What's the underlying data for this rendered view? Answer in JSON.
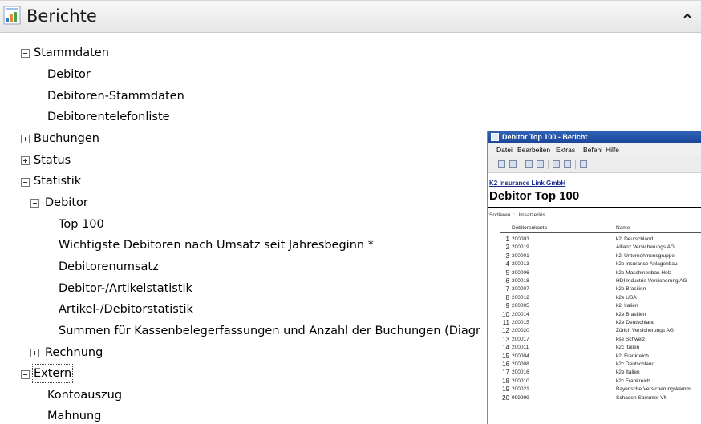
{
  "header": {
    "title": "Berichte",
    "icon": "report-chart-icon",
    "collapse_icon": "chevron-up-icon"
  },
  "tree": {
    "stammdaten": {
      "label": "Stammdaten",
      "children": [
        "Debitor",
        "Debitoren-Stammdaten",
        "Debitorentelefonliste"
      ]
    },
    "buchungen": {
      "label": "Buchungen"
    },
    "status": {
      "label": "Status"
    },
    "statistik": {
      "label": "Statistik"
    },
    "debitor": {
      "label": "Debitor",
      "children": [
        "Top 100",
        "Wichtigste Debitoren nach Umsatz seit Jahresbeginn *",
        "Debitorenumsatz",
        "Debitor-/Artikelstatistik",
        "Artikel-/Debitorstatistik",
        "Summen für Kassenbelegerfassungen und Anzahl der Buchungen (Diagra"
      ]
    },
    "rechnung": {
      "label": "Rechnung"
    },
    "extern": {
      "label": "Extern",
      "children": [
        "Kontoauszug",
        "Mahnung"
      ]
    }
  },
  "report_window": {
    "title": "Debitor Top 100 - Bericht",
    "menu": [
      "Datei",
      "Bearbeiten",
      "Extras",
      "Befehl",
      "Hilfe"
    ],
    "company": "K2 Insurance Link GmbH",
    "report_title": "Debitor Top 100",
    "sort_label": "Sortieren  .: Umsatzerlös",
    "col_account": "Debitorenkonto",
    "col_name": "Name",
    "rows": [
      {
        "rank": "1",
        "account": "200003",
        "name": "k2i Deutschland"
      },
      {
        "rank": "2",
        "account": "200019",
        "name": "Allianz Versicherungs AG"
      },
      {
        "rank": "3",
        "account": "200001",
        "name": "k2i Unternehmensgruppe"
      },
      {
        "rank": "4",
        "account": "200013",
        "name": "k2e insurance Anlagenbau"
      },
      {
        "rank": "5",
        "account": "200006",
        "name": "k2e Maschinenbau Holz"
      },
      {
        "rank": "6",
        "account": "200018",
        "name": "HDI Industrie Versicherung AG"
      },
      {
        "rank": "7",
        "account": "200007",
        "name": "k2e Brasilien"
      },
      {
        "rank": "8",
        "account": "200012",
        "name": "k2e USA"
      },
      {
        "rank": "9",
        "account": "200005",
        "name": "k2i Italien"
      },
      {
        "rank": "10",
        "account": "200014",
        "name": "k2e Brasilien"
      },
      {
        "rank": "11",
        "account": "200015",
        "name": "k2e Deutschland"
      },
      {
        "rank": "12",
        "account": "200020",
        "name": "Zürich Versicherungs AG"
      },
      {
        "rank": "13",
        "account": "200017",
        "name": "kse Schweiz"
      },
      {
        "rank": "14",
        "account": "200011",
        "name": "k2c Italien"
      },
      {
        "rank": "15",
        "account": "200004",
        "name": "k2i Frankreich"
      },
      {
        "rank": "16",
        "account": "200008",
        "name": "k2c Deutschland"
      },
      {
        "rank": "17",
        "account": "200016",
        "name": "k2e Italien"
      },
      {
        "rank": "18",
        "account": "200010",
        "name": "k2c Frankreich"
      },
      {
        "rank": "19",
        "account": "200021",
        "name": "Bayerische Versicherungskamm"
      },
      {
        "rank": "20",
        "account": "999999",
        "name": "Schaden Sammler VN"
      }
    ]
  }
}
